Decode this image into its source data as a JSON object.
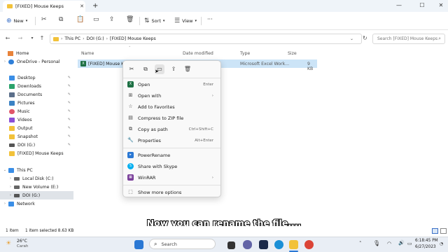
{
  "window": {
    "tab_title": "[FIXED] Mouse Keeps",
    "tab_close": "✕",
    "new_tab": "+",
    "minimize": "—",
    "maximize": "☐",
    "close": "✕"
  },
  "toolbar": {
    "new_label": "New",
    "sort_label": "Sort",
    "view_label": "View",
    "more_label": "···"
  },
  "address": {
    "segments": [
      "This PC",
      "DOI (G:)",
      "[FIXED] Mouse Keeps"
    ],
    "separator": "›",
    "search_placeholder": "Search [FIXED] Mouse Keeps"
  },
  "sidebar": {
    "items": [
      {
        "label": "Home",
        "icon": "home-icon",
        "color": "#e8833a"
      },
      {
        "label": "OneDrive - Personal",
        "icon": "cloud-icon",
        "color": "#2f7fd8"
      },
      {
        "label": "Desktop",
        "icon": "desktop-icon",
        "color": "#3a8ee6"
      },
      {
        "label": "Downloads",
        "icon": "download-icon",
        "color": "#2aa36b"
      },
      {
        "label": "Documents",
        "icon": "documents-icon",
        "color": "#5b6f8a"
      },
      {
        "label": "Pictures",
        "icon": "pictures-icon",
        "color": "#3b82c4"
      },
      {
        "label": "Music",
        "icon": "music-icon",
        "color": "#e0556a"
      },
      {
        "label": "Videos",
        "icon": "videos-icon",
        "color": "#8a4fd6"
      },
      {
        "label": "Output",
        "icon": "folder-icon",
        "color": "#f2c23a"
      },
      {
        "label": "Snapshot",
        "icon": "folder-icon",
        "color": "#f2c23a"
      },
      {
        "label": "DOI (G:)",
        "icon": "drive-icon",
        "color": "#555555"
      },
      {
        "label": "[FIXED] Mouse Keeps",
        "icon": "folder-icon",
        "color": "#f2c23a"
      },
      {
        "label": "This PC",
        "icon": "pc-icon",
        "color": "#3a8ee6"
      },
      {
        "label": "Local Disk (C:)",
        "icon": "drive-icon",
        "color": "#666666"
      },
      {
        "label": "New Volume (E:)",
        "icon": "drive-icon",
        "color": "#666666"
      },
      {
        "label": "DOI (G:)",
        "icon": "drive-icon",
        "color": "#555555"
      },
      {
        "label": "Network",
        "icon": "network-icon",
        "color": "#3a8ee6"
      }
    ],
    "pin": "📌"
  },
  "files": {
    "columns": [
      "Name",
      "Date modified",
      "Type",
      "Size"
    ],
    "rows": [
      {
        "name": "[FIXED] Mouse Ke",
        "type": "Microsoft Excel Work...",
        "size": "9 KB"
      }
    ]
  },
  "context_menu": {
    "quick_actions": [
      "cut-icon",
      "copy-icon",
      "rename-icon",
      "share-icon",
      "delete-icon"
    ],
    "items": [
      {
        "label": "Open",
        "shortcut": "Enter",
        "icon": "excel-icon",
        "arrow": ""
      },
      {
        "label": "Open with",
        "shortcut": "",
        "icon": "open-with-icon",
        "arrow": "›"
      },
      {
        "label": "Add to Favorites",
        "shortcut": "",
        "icon": "star-icon",
        "arrow": ""
      },
      {
        "label": "Compress to ZIP file",
        "shortcut": "",
        "icon": "zip-icon",
        "arrow": ""
      },
      {
        "label": "Copy as path",
        "shortcut": "Ctrl+Shift+C",
        "icon": "path-icon",
        "arrow": ""
      },
      {
        "label": "Properties",
        "shortcut": "Alt+Enter",
        "icon": "properties-icon",
        "arrow": ""
      },
      {
        "label": "PowerRename",
        "shortcut": "",
        "icon": "powerrename-icon",
        "arrow": ""
      },
      {
        "label": "Share with Skype",
        "shortcut": "",
        "icon": "skype-icon",
        "arrow": ""
      },
      {
        "label": "WinRAR",
        "shortcut": "",
        "icon": "winrar-icon",
        "arrow": "›"
      },
      {
        "label": "Show more options",
        "shortcut": "",
        "icon": "more-options-icon",
        "arrow": ""
      }
    ]
  },
  "status": {
    "count": "1 item",
    "selected": "1 item selected  8.63 KB"
  },
  "subtitle": "Now you can rename the file....",
  "taskbar": {
    "weather_temp": "26°C",
    "weather_desc": "Carah",
    "search_label": "Search",
    "time": "6:18:45 PM",
    "date": "6/27/2023",
    "lang": "ENG"
  }
}
